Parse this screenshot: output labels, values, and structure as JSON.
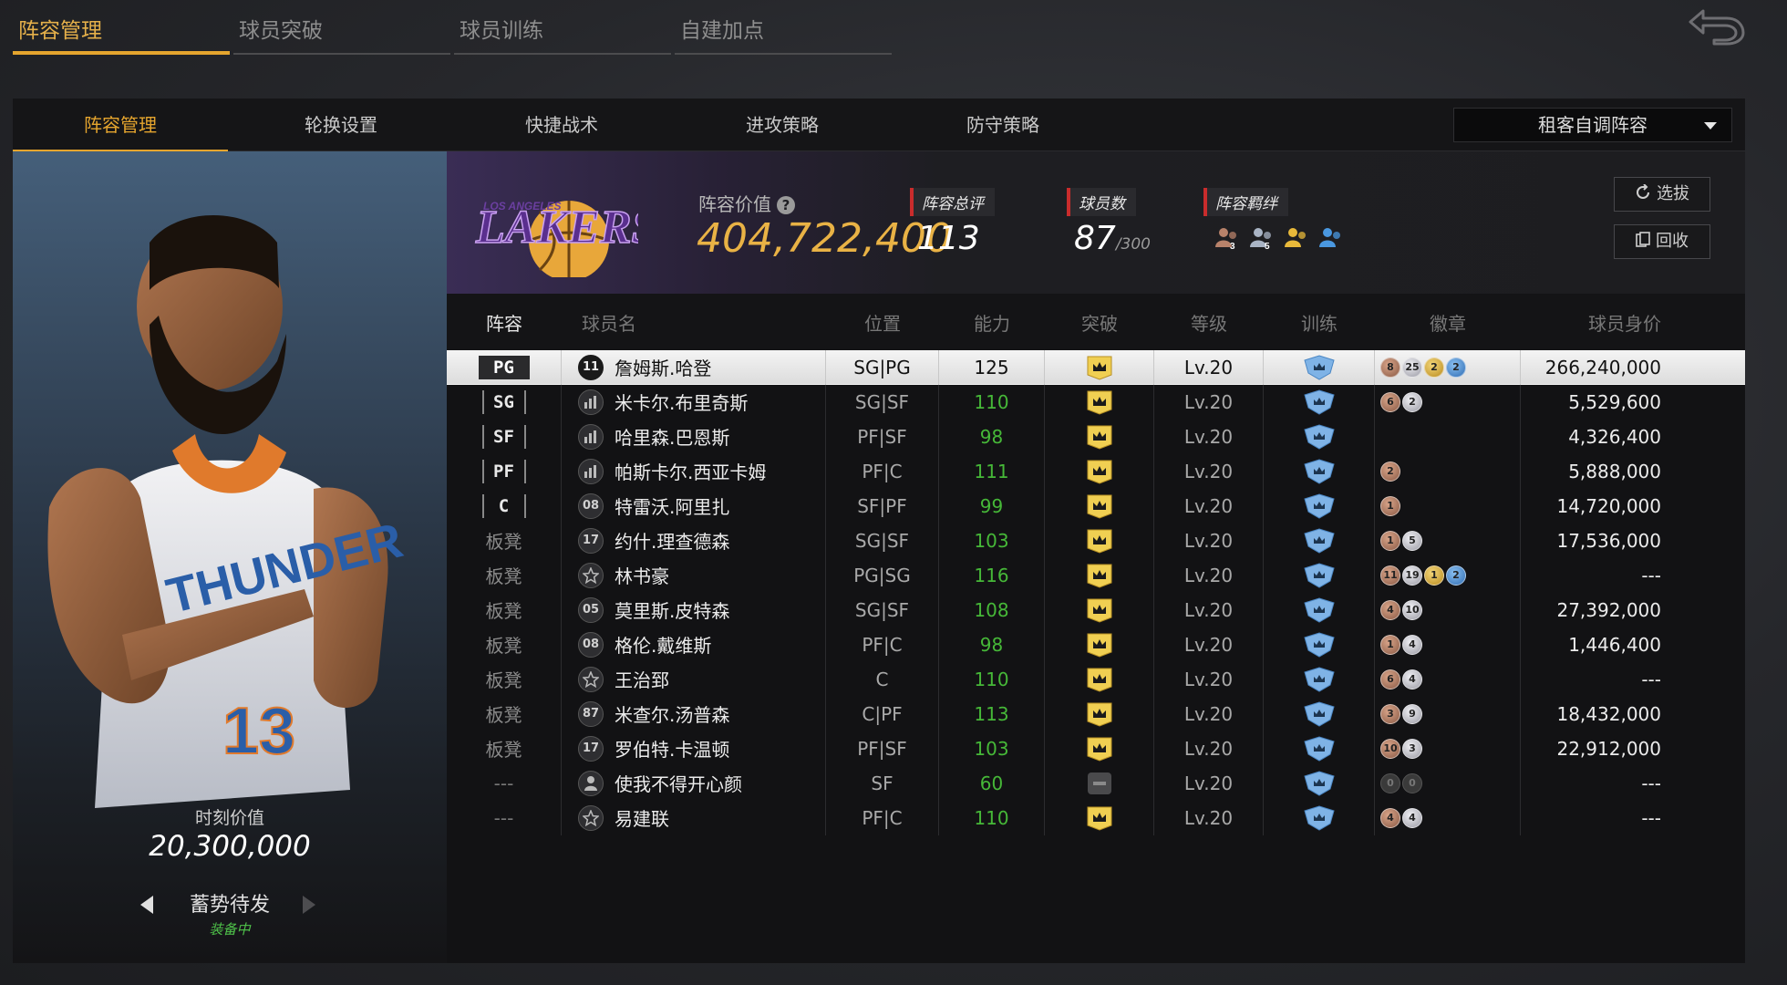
{
  "top_tabs": [
    {
      "label": "阵容管理",
      "active": true
    },
    {
      "label": "球员突破",
      "active": false
    },
    {
      "label": "球员训练",
      "active": false
    },
    {
      "label": "自建加点",
      "active": false
    }
  ],
  "sub_tabs": [
    {
      "label": "阵容管理",
      "active": true
    },
    {
      "label": "轮换设置",
      "active": false
    },
    {
      "label": "快捷战术",
      "active": false
    },
    {
      "label": "进攻策略",
      "active": false
    },
    {
      "label": "防守策略",
      "active": false
    }
  ],
  "lineup_select": {
    "value": "租客自调阵容"
  },
  "player_card": {
    "moment_label": "时刻价值",
    "moment_value": "20,300,000",
    "status": "蓄势待发",
    "equip_status": "装备中"
  },
  "team": {
    "value_label": "阵容价值",
    "value": "404,722,400",
    "rating_label": "阵容总评",
    "rating": "113",
    "players_label": "球员数",
    "players": "87",
    "players_max": "/300",
    "bond_label": "阵容羁绊",
    "bond_icons": [
      {
        "color": "#b8826a",
        "num": "3"
      },
      {
        "color": "#a9b4c4",
        "num": "5"
      },
      {
        "color": "#e8b93a",
        "num": ""
      },
      {
        "color": "#4a98e0",
        "num": ""
      }
    ],
    "select_button": "选拔",
    "recycle_button": "回收"
  },
  "table": {
    "headers": [
      "阵容",
      "球员名",
      "位置",
      "能力",
      "突破",
      "等级",
      "训练",
      "徽章",
      "球员身价"
    ],
    "rows": [
      {
        "slot": "PG",
        "slot_type": "starter",
        "jersey": "11",
        "name": "詹姆斯.哈登",
        "pos": "SG|PG",
        "ability": "125",
        "breakthrough": "crown",
        "level": "Lv.20",
        "badges": [
          {
            "t": "bronze",
            "n": "8"
          },
          {
            "t": "silver",
            "n": "25"
          },
          {
            "t": "gold",
            "n": "2"
          },
          {
            "t": "blue",
            "n": "2"
          }
        ],
        "value": "266,240,000",
        "selected": true
      },
      {
        "slot": "SG",
        "slot_type": "starter",
        "jersey": "icon",
        "name": "米卡尔.布里奇斯",
        "pos": "SG|SF",
        "ability": "110",
        "breakthrough": "crown",
        "level": "Lv.20",
        "badges": [
          {
            "t": "bronze",
            "n": "6"
          },
          {
            "t": "silver",
            "n": "2"
          }
        ],
        "value": "5,529,600"
      },
      {
        "slot": "SF",
        "slot_type": "starter",
        "jersey": "icon",
        "name": "哈里森.巴恩斯",
        "pos": "PF|SF",
        "ability": "98",
        "breakthrough": "crown",
        "level": "Lv.20",
        "badges": [],
        "value": "4,326,400"
      },
      {
        "slot": "PF",
        "slot_type": "starter",
        "jersey": "icon",
        "name": "帕斯卡尔.西亚卡姆",
        "pos": "PF|C",
        "ability": "111",
        "breakthrough": "crown",
        "level": "Lv.20",
        "badges": [
          {
            "t": "bronze",
            "n": "2"
          }
        ],
        "value": "5,888,000"
      },
      {
        "slot": "C",
        "slot_type": "starter",
        "jersey": "08",
        "name": "特雷沃.阿里扎",
        "pos": "SF|PF",
        "ability": "99",
        "breakthrough": "crown",
        "level": "Lv.20",
        "badges": [
          {
            "t": "bronze",
            "n": "1"
          }
        ],
        "value": "14,720,000"
      },
      {
        "slot": "板凳",
        "slot_type": "bench",
        "jersey": "17",
        "name": "约什.理查德森",
        "pos": "SG|SF",
        "ability": "103",
        "breakthrough": "crown",
        "level": "Lv.20",
        "badges": [
          {
            "t": "bronze",
            "n": "1"
          },
          {
            "t": "silver",
            "n": "5"
          }
        ],
        "value": "17,536,000"
      },
      {
        "slot": "板凳",
        "slot_type": "bench",
        "jersey": "star",
        "name": "林书豪",
        "pos": "PG|SG",
        "ability": "116",
        "breakthrough": "crown",
        "level": "Lv.20",
        "badges": [
          {
            "t": "bronze",
            "n": "11"
          },
          {
            "t": "silver",
            "n": "19"
          },
          {
            "t": "gold",
            "n": "1"
          },
          {
            "t": "blue",
            "n": "2"
          }
        ],
        "value": "---"
      },
      {
        "slot": "板凳",
        "slot_type": "bench",
        "jersey": "05",
        "name": "莫里斯.皮特森",
        "pos": "SG|SF",
        "ability": "108",
        "breakthrough": "crown",
        "level": "Lv.20",
        "badges": [
          {
            "t": "bronze",
            "n": "4"
          },
          {
            "t": "silver",
            "n": "10"
          }
        ],
        "value": "27,392,000"
      },
      {
        "slot": "板凳",
        "slot_type": "bench",
        "jersey": "08",
        "name": "格伦.戴维斯",
        "pos": "PF|C",
        "ability": "98",
        "breakthrough": "crown",
        "level": "Lv.20",
        "badges": [
          {
            "t": "bronze",
            "n": "1"
          },
          {
            "t": "silver",
            "n": "4"
          }
        ],
        "value": "1,446,400"
      },
      {
        "slot": "板凳",
        "slot_type": "bench",
        "jersey": "star",
        "name": "王治郅",
        "pos": "C",
        "ability": "110",
        "breakthrough": "crown",
        "level": "Lv.20",
        "badges": [
          {
            "t": "bronze",
            "n": "6"
          },
          {
            "t": "silver",
            "n": "4"
          }
        ],
        "value": "---"
      },
      {
        "slot": "板凳",
        "slot_type": "bench",
        "jersey": "87",
        "name": "米查尔.汤普森",
        "pos": "C|PF",
        "ability": "113",
        "breakthrough": "crown",
        "level": "Lv.20",
        "badges": [
          {
            "t": "bronze",
            "n": "3"
          },
          {
            "t": "silver",
            "n": "9"
          }
        ],
        "value": "18,432,000"
      },
      {
        "slot": "板凳",
        "slot_type": "bench",
        "jersey": "17",
        "name": "罗伯特.卡温顿",
        "pos": "PF|SF",
        "ability": "103",
        "breakthrough": "crown",
        "level": "Lv.20",
        "badges": [
          {
            "t": "bronze",
            "n": "10"
          },
          {
            "t": "silver",
            "n": "3"
          }
        ],
        "value": "22,912,000"
      },
      {
        "slot": "---",
        "slot_type": "none",
        "jersey": "person",
        "name": "使我不得开心颜",
        "pos": "SF",
        "ability": "60",
        "breakthrough": "locked",
        "level": "Lv.20",
        "badges": [
          {
            "t": "dark",
            "n": "0"
          },
          {
            "t": "dark",
            "n": "0"
          }
        ],
        "value": "---"
      },
      {
        "slot": "---",
        "slot_type": "none",
        "jersey": "star",
        "name": "易建联",
        "pos": "PF|C",
        "ability": "110",
        "breakthrough": "crown",
        "level": "Lv.20",
        "badges": [
          {
            "t": "bronze",
            "n": "4"
          },
          {
            "t": "silver",
            "n": "4"
          }
        ],
        "value": "---"
      }
    ]
  },
  "colors": {
    "accent": "#e5a52e",
    "team_value": "#e9b245",
    "ability_green": "#46b838",
    "equip_green": "#4fc34a",
    "stat_red": "#c92c2c"
  }
}
